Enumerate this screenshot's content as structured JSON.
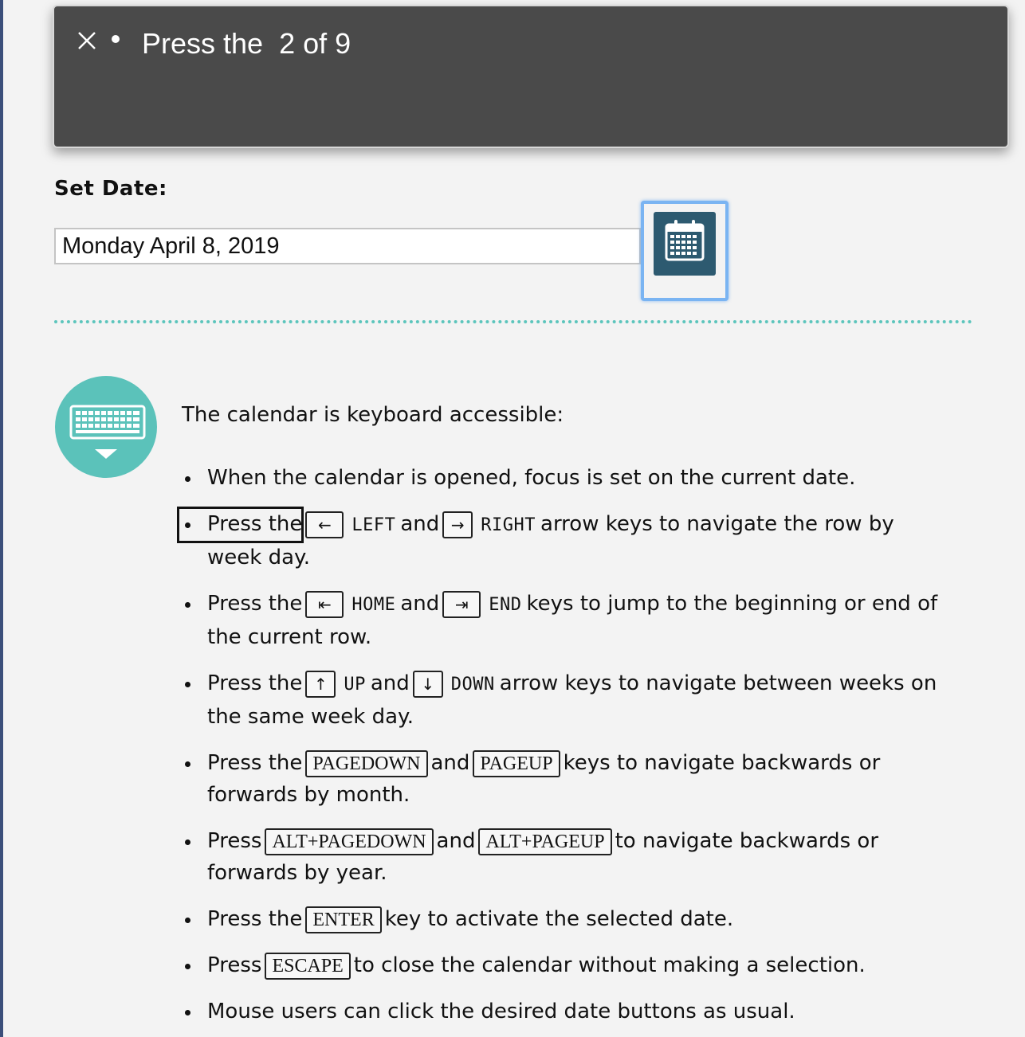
{
  "toast": {
    "text": "Press the  2 of 9"
  },
  "date_picker": {
    "label": "Set Date:",
    "value": "Monday April 8, 2019"
  },
  "help": {
    "intro": "The calendar is keyboard accessible:",
    "items": [
      {
        "t1": "When the calendar is opened, focus is set on the current date."
      },
      {
        "t1": "Press the",
        "k1": "←",
        "n1": "LEFT",
        "t2": "and",
        "k2": "→",
        "n2": "RIGHT",
        "t3": "arrow keys to navigate the row by week day."
      },
      {
        "t1": "Press the",
        "k1": "⇤",
        "n1": "HOME",
        "t2": "and",
        "k2": "⇥",
        "n2": "END",
        "t3": "keys to jump to the beginning or end of the current row."
      },
      {
        "t1": "Press the",
        "k1": "↑",
        "n1": "UP",
        "t2": "and",
        "k2": "↓",
        "n2": "DOWN",
        "t3": "arrow keys to navigate between weeks on the same week day."
      },
      {
        "t1": "Press the",
        "k1": "PAGEDOWN",
        "t2": "and",
        "k2": "PAGEUP",
        "t3": "keys to navigate backwards or forwards by month."
      },
      {
        "t1": "Press",
        "k1": "ALT+PAGEDOWN",
        "t2": "and",
        "k2": "ALT+PAGEUP",
        "t3": "to navigate backwards or forwards by year."
      },
      {
        "t1": "Press the",
        "k1": "ENTER",
        "t3": "key to activate the selected date."
      },
      {
        "t1": "Press",
        "k1": "ESCAPE",
        "t3": "to close the calendar without making a selection."
      },
      {
        "t1": "Mouse users can click the desired date buttons as usual."
      }
    ]
  },
  "colors": {
    "toast_bg": "#4a4a4a",
    "accent_teal": "#5bc2ba",
    "calendar_icon": "#2d5a70",
    "focus_blue": "#7ab4f2"
  },
  "icons": [
    "close-icon",
    "calendar-icon",
    "keyboard-icon"
  ]
}
